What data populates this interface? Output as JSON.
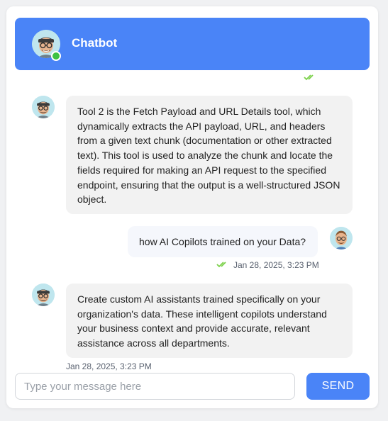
{
  "header": {
    "title": "Chatbot",
    "status": "online"
  },
  "messages": [
    {
      "role": "bot",
      "text": "Tool 2 is the Fetch Payload and URL Details tool, which dynamically extracts the API payload, URL, and headers from a given text chunk (documentation or other extracted text). This tool is used to analyze the chunk and locate the fields required for making an API request to the specified endpoint, ensuring that the output is a well-structured JSON object."
    },
    {
      "role": "user",
      "text": "how AI Copilots trained on your Data?",
      "timestamp": "Jan 28, 2025, 3:23 PM",
      "read_icon": "double-check-icon"
    },
    {
      "role": "bot",
      "text": "Create custom AI assistants trained specifically on your organization's data. These intelligent copilots understand your business context and provide accurate, relevant assistance across all departments.",
      "timestamp": "Jan 28, 2025, 3:23 PM"
    }
  ],
  "composer": {
    "placeholder": "Type your message here",
    "send_label": "SEND"
  },
  "colors": {
    "accent": "#4a84f7",
    "online": "#3ec243",
    "read_ticks": "#7bd14a",
    "bot_bubble": "#f2f2f2",
    "user_bubble": "#f5f7fc"
  }
}
